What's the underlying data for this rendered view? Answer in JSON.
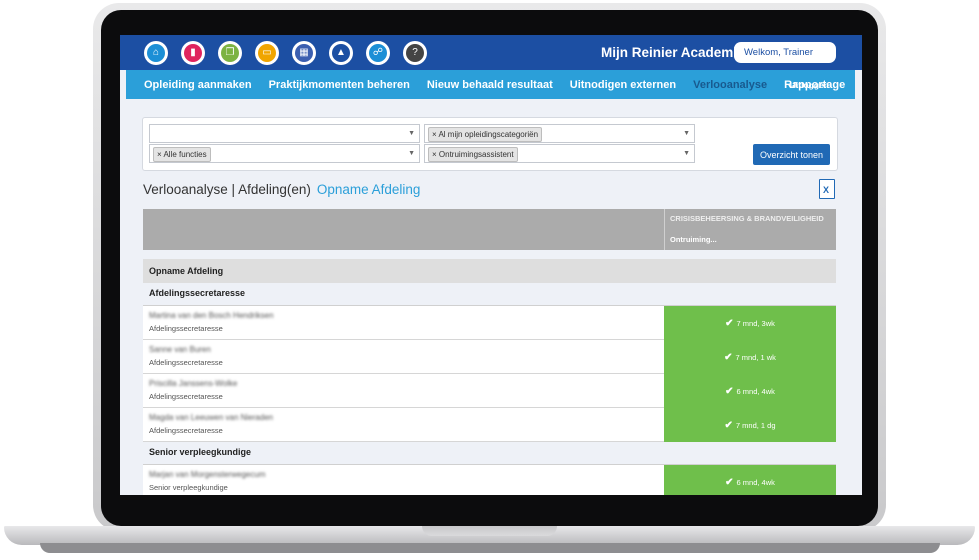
{
  "app": {
    "brand": "Mijn Reinier Academie",
    "user_greeting": "Welkom, Trainer"
  },
  "top_icons": [
    {
      "name": "home-icon",
      "glyph": "⌂",
      "color": "#1c8fd6"
    },
    {
      "name": "book-icon",
      "glyph": "▮",
      "color": "#e0245e"
    },
    {
      "name": "documents-icon",
      "glyph": "❐",
      "color": "#7cb342"
    },
    {
      "name": "laptop-icon",
      "glyph": "▭",
      "color": "#f0a500"
    },
    {
      "name": "calendar-icon",
      "glyph": "▦",
      "color": "#3b5fb0"
    },
    {
      "name": "graduation-cap-icon",
      "glyph": "▲",
      "color": "#1c4fa3"
    },
    {
      "name": "org-chart-icon",
      "glyph": "☍",
      "color": "#1c8fd6"
    },
    {
      "name": "help-icon",
      "glyph": "?",
      "color": "#444444"
    }
  ],
  "nav": {
    "items": [
      "Opleiding aanmaken",
      "Praktijkmomenten beheren",
      "Nieuw behaald resultaat",
      "Uitnodigen externen",
      "Verlooanalyse",
      "Rapportage"
    ],
    "active_index": 4,
    "logout": "Uitloggen"
  },
  "filters": {
    "category_tag": "Al mijn opleidingscategoriën",
    "function_tag": "Alle functies",
    "training_tag": "Ontruimingsassistent",
    "submit": "Overzicht tonen"
  },
  "page": {
    "title": "Verlooanalyse | Afdeling(en)",
    "department": "Opname Afdeling",
    "export_icon": "excel-export-icon"
  },
  "table": {
    "column_category": "CRISISBEHEERSING & BRANDVEILIGHEID",
    "column_course": "Ontruiming...",
    "group": "Opname Afdeling",
    "sections": [
      {
        "title": "Afdelingssecretaresse",
        "rows": [
          {
            "name": "Martina van den Bosch Hendriksen",
            "role": "Afdelingssecretaresse",
            "status": "7 mnd, 3wk"
          },
          {
            "name": "Sanne van Buren",
            "role": "Afdelingssecretaresse",
            "status": "7 mnd, 1 wk"
          },
          {
            "name": "Priscilla Janssens-Wolke",
            "role": "Afdelingssecretaresse",
            "status": "6 mnd, 4wk"
          },
          {
            "name": "Magda van Leeuwen van Nieraden",
            "role": "Afdelingssecretaresse",
            "status": "7 mnd, 1 dg"
          }
        ]
      },
      {
        "title": "Senior verpleegkundige",
        "rows": [
          {
            "name": "Marjan van Morgensterwegecum",
            "role": "Senior verpleegkundige",
            "status": "6 mnd, 4wk"
          }
        ]
      }
    ]
  }
}
